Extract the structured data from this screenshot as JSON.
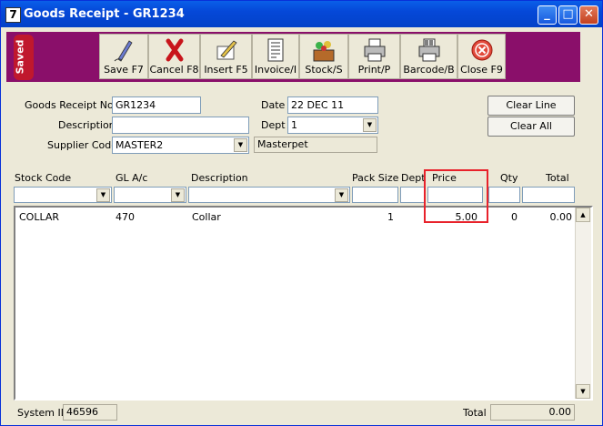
{
  "window": {
    "title": "Goods Receipt - GR1234",
    "app_icon_text": "7"
  },
  "toolbar": {
    "saved_label": "Saved",
    "buttons": [
      {
        "label": "Save F7",
        "icon": "pen-icon"
      },
      {
        "label": "Cancel F8",
        "icon": "cross-icon"
      },
      {
        "label": "Insert F5",
        "icon": "insert-icon"
      },
      {
        "label": "Invoice/I",
        "icon": "invoice-icon"
      },
      {
        "label": "Stock/S",
        "icon": "stock-icon"
      },
      {
        "label": "Print/P",
        "icon": "printer-icon"
      },
      {
        "label": "Barcode/B",
        "icon": "barcode-printer-icon"
      },
      {
        "label": "Close F9",
        "icon": "close-circle-icon"
      }
    ]
  },
  "header": {
    "receipt_no_label": "Goods Receipt No.",
    "receipt_no": "GR1234",
    "description_label": "Description",
    "description": "",
    "supplier_label": "Supplier Code",
    "supplier": "MASTER2",
    "supplier_name": "Masterpet",
    "date_label": "Date",
    "date": "22 DEC 11",
    "dept_label": "Dept",
    "dept": "1",
    "clear_line": "Clear Line",
    "clear_all": "Clear All"
  },
  "grid": {
    "columns": [
      "Stock Code",
      "GL A/c",
      "Description",
      "Pack Size",
      "Dept",
      "Price",
      "Qty",
      "Total"
    ],
    "rows": [
      {
        "stock_code": "COLLAR",
        "gl": "470",
        "description": "Collar",
        "pack_size": "1",
        "dept": "",
        "price": "5.00",
        "qty": "0",
        "total": "0.00"
      }
    ]
  },
  "footer": {
    "system_id_label": "System ID",
    "system_id": "46596",
    "total_label": "Total",
    "total": "0.00"
  },
  "colors": {
    "toolbar_bg": "#8a0f6a",
    "saved_badge": "#c0182d",
    "highlight": "#e8222b",
    "titlebar": "#0548d8"
  }
}
